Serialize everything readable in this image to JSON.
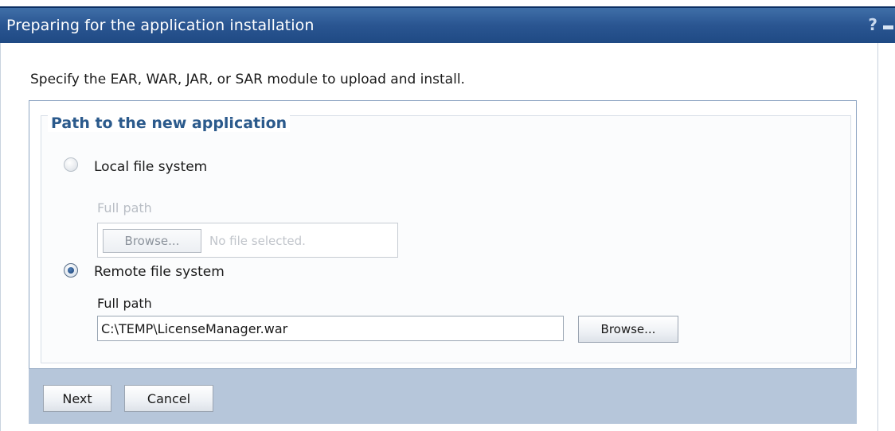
{
  "window": {
    "title": "Preparing for the application installation",
    "help_label": "?",
    "minimize_label": ""
  },
  "intro": "Specify the EAR, WAR, JAR, or SAR module to upload and install.",
  "fieldset": {
    "legend": "Path to the new application",
    "local": {
      "label": "Local file system",
      "selected": false,
      "caption": "Full path",
      "browse_label": "Browse...",
      "no_file_text": "No file selected."
    },
    "remote": {
      "label": "Remote file system",
      "selected": true,
      "caption": "Full path",
      "path_value": "C:\\TEMP\\LicenseManager.war",
      "browse_label": "Browse..."
    }
  },
  "footer": {
    "next_label": "Next",
    "cancel_label": "Cancel"
  },
  "colors": {
    "titlebar": "#2a5591",
    "legend": "#2b5a8c",
    "footer_bar": "#b6c6da"
  }
}
